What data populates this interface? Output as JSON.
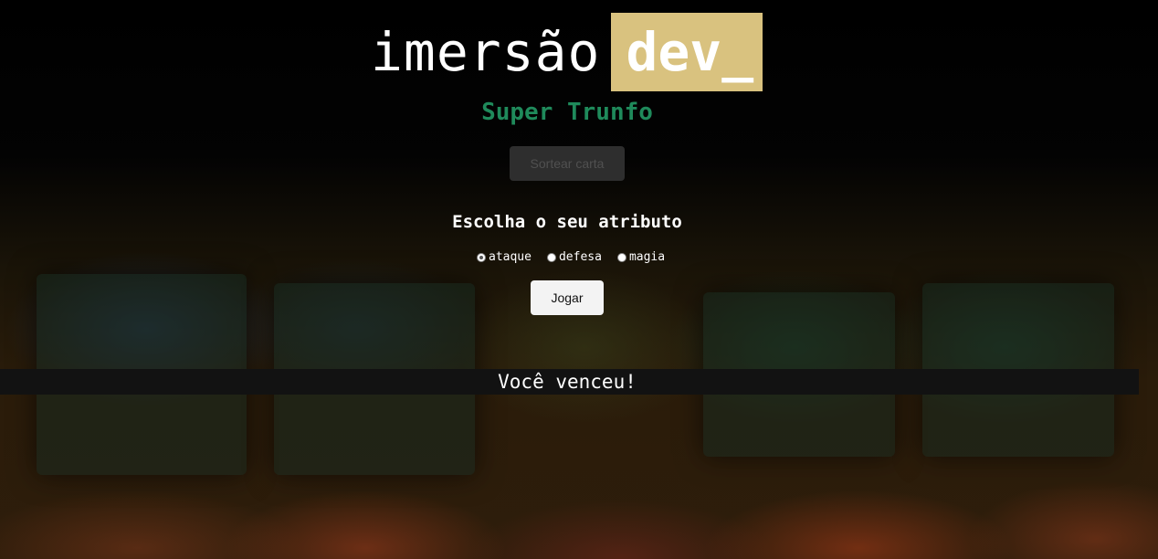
{
  "logo": {
    "text": "imersão",
    "highlight": "dev_"
  },
  "title": "Super Trunfo",
  "draw_button": {
    "label": "Sortear carta",
    "state": "disabled"
  },
  "attribute_prompt": "Escolha o seu atributo",
  "attributes": [
    {
      "label": "ataque",
      "checked": true
    },
    {
      "label": "defesa",
      "checked": false
    },
    {
      "label": "magia",
      "checked": false
    }
  ],
  "play_button": {
    "label": "Jogar"
  },
  "result": "Você venceu!",
  "colors": {
    "title": "#1f8a5b",
    "logo_highlight_bg": "#d9c27f",
    "page_bg": "#000000",
    "result_bar_bg": "#121212"
  }
}
